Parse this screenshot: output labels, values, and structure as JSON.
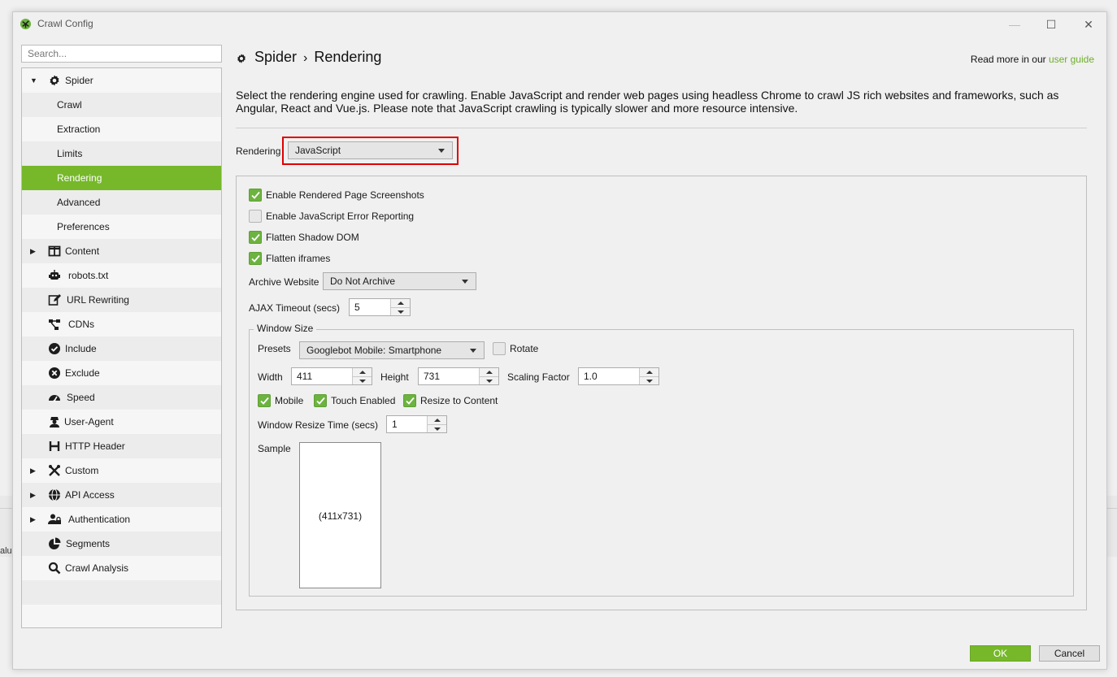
{
  "window": {
    "title": "Crawl Config",
    "minimize": "—",
    "maximize": "☐",
    "close": "✕"
  },
  "background": {
    "fragment_text": "alu"
  },
  "search": {
    "placeholder": "Search..."
  },
  "sidebar": {
    "items": [
      {
        "label": "Spider",
        "icon": "gear-icon",
        "expanded": true
      },
      {
        "label": "Crawl"
      },
      {
        "label": "Extraction"
      },
      {
        "label": "Limits"
      },
      {
        "label": "Rendering",
        "selected": true
      },
      {
        "label": "Advanced"
      },
      {
        "label": "Preferences"
      },
      {
        "label": "Content",
        "icon": "columns-icon"
      },
      {
        "label": "robots.txt",
        "icon": "robot-icon"
      },
      {
        "label": "URL Rewriting",
        "icon": "edit-icon"
      },
      {
        "label": "CDNs",
        "icon": "network-icon"
      },
      {
        "label": "Include",
        "icon": "check-circle-icon"
      },
      {
        "label": "Exclude",
        "icon": "x-circle-icon"
      },
      {
        "label": "Speed",
        "icon": "speedometer-icon"
      },
      {
        "label": "User-Agent",
        "icon": "user-agent-icon"
      },
      {
        "label": "HTTP Header",
        "icon": "header-h-icon"
      },
      {
        "label": "Custom",
        "icon": "tools-icon"
      },
      {
        "label": "API Access",
        "icon": "globe-icon"
      },
      {
        "label": "Authentication",
        "icon": "user-lock-icon"
      },
      {
        "label": "Segments",
        "icon": "pie-chart-icon"
      },
      {
        "label": "Crawl Analysis",
        "icon": "search-icon"
      }
    ]
  },
  "header": {
    "section": "Spider",
    "separator": "›",
    "page": "Rendering",
    "read_more": "Read more in our ",
    "link": "user guide"
  },
  "description": "Select the rendering engine used for crawling. Enable JavaScript and render web pages using headless Chrome to crawl JS rich websites and frameworks, such as Angular, React and Vue.js. Please note that JavaScript crawling is typically slower and more resource intensive.",
  "rendering": {
    "label": "Rendering",
    "value": "JavaScript"
  },
  "options": {
    "screenshots": {
      "label": "Enable Rendered Page Screenshots",
      "checked": true
    },
    "js_errors": {
      "label": "Enable JavaScript Error Reporting",
      "checked": false
    },
    "shadow_dom": {
      "label": "Flatten Shadow DOM",
      "checked": true
    },
    "iframes": {
      "label": "Flatten iframes",
      "checked": true
    }
  },
  "archive": {
    "label": "Archive Website",
    "value": "Do Not Archive"
  },
  "ajax": {
    "label": "AJAX Timeout (secs)",
    "value": "5"
  },
  "window_size": {
    "title": "Window Size",
    "presets_label": "Presets",
    "preset_value": "Googlebot Mobile: Smartphone",
    "rotate": {
      "label": "Rotate",
      "checked": false
    },
    "width_label": "Width",
    "width": "411",
    "height_label": "Height",
    "height": "731",
    "scaling_label": "Scaling Factor",
    "scaling": "1.0",
    "mobile": {
      "label": "Mobile",
      "checked": true
    },
    "touch": {
      "label": "Touch Enabled",
      "checked": true
    },
    "resize": {
      "label": "Resize to Content",
      "checked": true
    },
    "resize_time_label": "Window Resize Time (secs)",
    "resize_time": "1",
    "sample_label": "Sample",
    "sample_text": "(411x731)"
  },
  "buttons": {
    "ok": "OK",
    "cancel": "Cancel"
  },
  "colors": {
    "accent": "#76b82a",
    "highlight": "#e00000",
    "link": "#6fae2a"
  }
}
